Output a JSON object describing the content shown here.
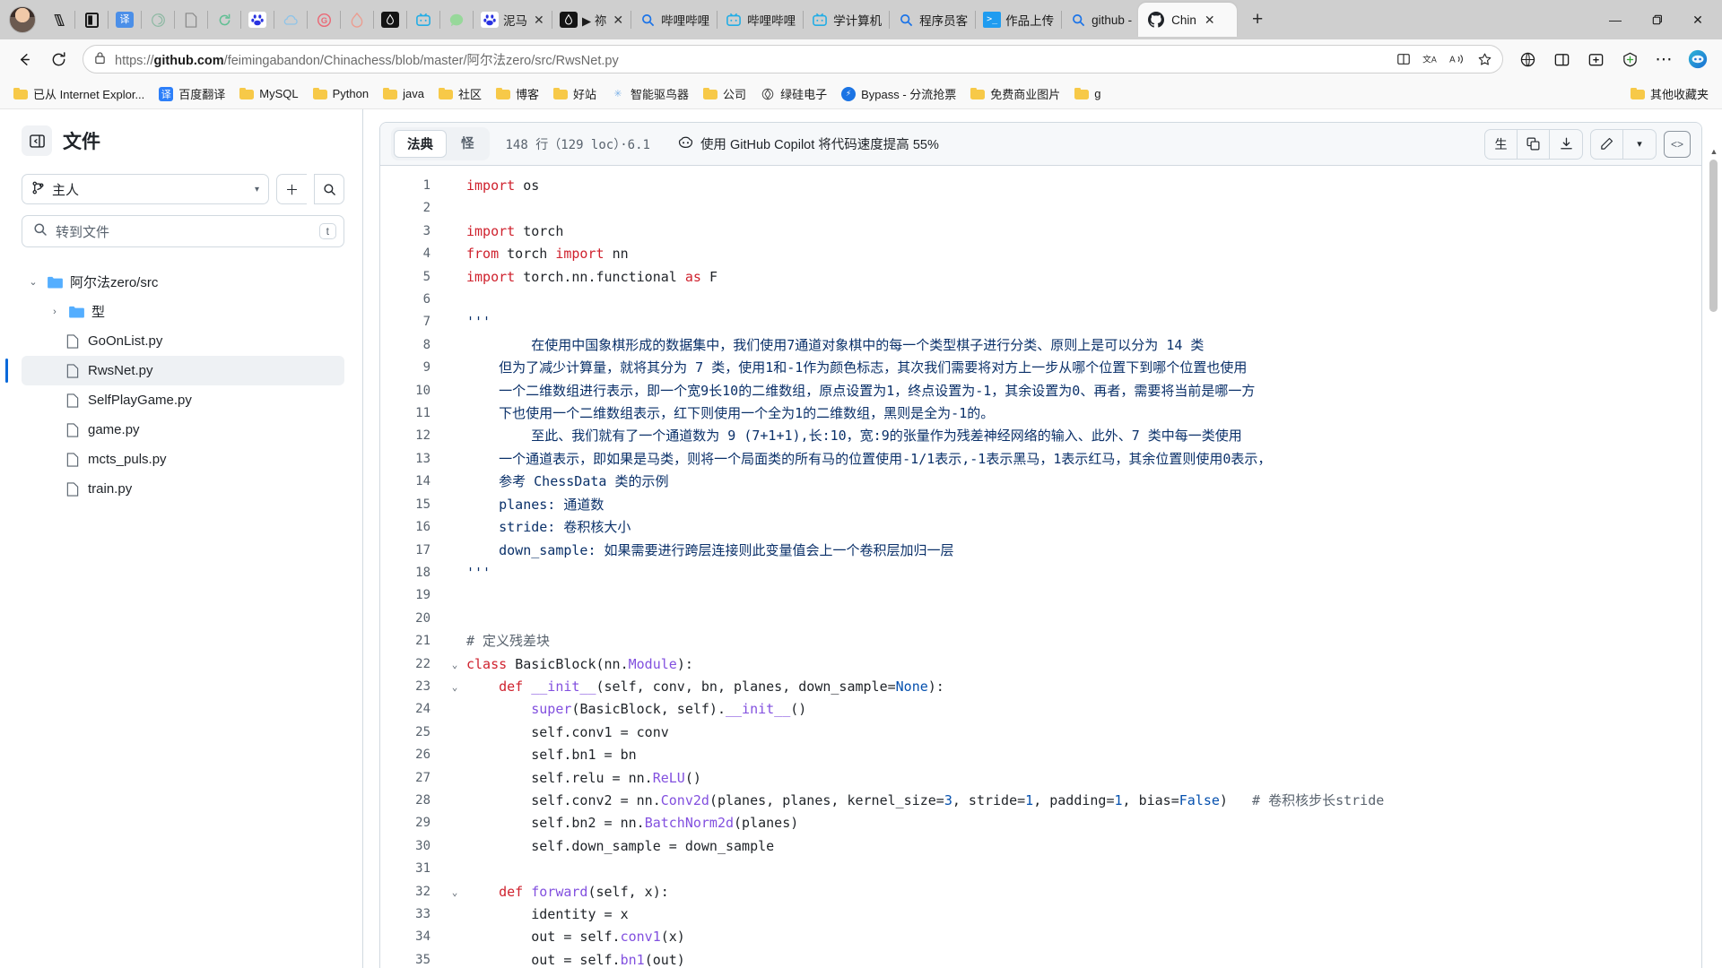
{
  "browser": {
    "pinned_tabs": [
      {
        "name": "books-icon",
        "label": ""
      },
      {
        "name": "reader-icon",
        "label": ""
      },
      {
        "name": "translate-icon",
        "label": ""
      },
      {
        "name": "openai-icon",
        "label": ""
      },
      {
        "name": "document-icon",
        "label": ""
      },
      {
        "name": "sync-icon",
        "label": ""
      },
      {
        "name": "baidu-icon",
        "label": ""
      },
      {
        "name": "cloud-icon",
        "label": ""
      },
      {
        "name": "g-icon",
        "label": ""
      },
      {
        "name": "flame-icon",
        "label": ""
      },
      {
        "name": "juejin-icon",
        "label": ""
      },
      {
        "name": "bilibili-icon",
        "label": ""
      },
      {
        "name": "wechat-icon",
        "label": ""
      }
    ],
    "tabs": [
      {
        "icon": "baidu-icon",
        "label": "泥马",
        "closable": true
      },
      {
        "icon": "juejin-icon",
        "label": "▶ 祢",
        "closable": true
      },
      {
        "icon": "search-icon",
        "label": "哔哩哔哩",
        "closable": false
      },
      {
        "icon": "bilibili-icon",
        "label": "哔哩哔哩",
        "closable": false
      },
      {
        "icon": "bilibili-icon",
        "label": "学计算机",
        "closable": false
      },
      {
        "icon": "search-icon",
        "label": "程序员客",
        "closable": false
      },
      {
        "icon": "terminal-icon",
        "label": "作品上传",
        "closable": false
      },
      {
        "icon": "search-icon",
        "label": "github -",
        "closable": false
      }
    ],
    "active_tab": {
      "icon": "github-icon",
      "label": "Chin",
      "close": "✕"
    },
    "new_tab_label": "+",
    "window_controls": {
      "minimize": "—",
      "maximize": "❐",
      "close": "✕"
    },
    "nav": {
      "back": "←",
      "reload": "⟳"
    },
    "address": {
      "lock": "🔒",
      "prefix": "https://",
      "domain": "github.com",
      "path": "/feimingabandon/Chinachess/blob/master/阿尔法zero/src/RwsNet.py",
      "split_icon": "⊞",
      "translate_icon": "文A",
      "read_aloud_icon": "A))",
      "favorite_icon": "☆",
      "collections_icon": "⊞",
      "split_screen_icon": "◫",
      "add_icon": "＋",
      "browser_essentials_icon": "◈",
      "more_icon": "⋯",
      "copilot_icon": "◉"
    },
    "bookmarks": [
      {
        "type": "folder",
        "label": "已从 Internet Explor..."
      },
      {
        "type": "site",
        "icon": "译",
        "color": "#2d7ff9",
        "label": "百度翻译"
      },
      {
        "type": "folder",
        "label": "MySQL"
      },
      {
        "type": "folder",
        "label": "Python"
      },
      {
        "type": "folder",
        "label": "java"
      },
      {
        "type": "folder",
        "label": "社区"
      },
      {
        "type": "folder",
        "label": "博客"
      },
      {
        "type": "folder",
        "label": "好站"
      },
      {
        "type": "site",
        "icon": "✳",
        "color": "#7fb3e8",
        "label": "智能驱鸟器"
      },
      {
        "type": "folder",
        "label": "公司"
      },
      {
        "type": "site",
        "icon": "◈",
        "color": "#444",
        "label": "绿硅电子"
      },
      {
        "type": "site",
        "icon": "⬤",
        "color": "#1b74e4",
        "label": "Bypass - 分流抢票"
      },
      {
        "type": "folder",
        "label": "免费商业图片"
      },
      {
        "type": "folder",
        "label": "g"
      }
    ],
    "bookmarks_right": {
      "type": "folder",
      "label": "其他收藏夹"
    }
  },
  "sidebar": {
    "collapse_icon": "◧",
    "title": "文件",
    "branch": {
      "icon": "⑂",
      "label": "主人",
      "caret": "▾"
    },
    "add_button": "＋",
    "search_button": "⌕",
    "find_file": {
      "icon": "⌕",
      "placeholder": "转到文件",
      "kbd": "t"
    },
    "tree": [
      {
        "level": 0,
        "type": "folder",
        "twist": "⌄",
        "label": "阿尔法zero/src",
        "selected": false
      },
      {
        "level": 1,
        "type": "folder",
        "twist": "›",
        "label": "型",
        "selected": false
      },
      {
        "level": 1,
        "type": "file",
        "twist": "",
        "label": "GoOnList.py",
        "selected": false
      },
      {
        "level": 1,
        "type": "file",
        "twist": "",
        "label": "RwsNet.py",
        "selected": true
      },
      {
        "level": 1,
        "type": "file",
        "twist": "",
        "label": "SelfPlayGame.py",
        "selected": false
      },
      {
        "level": 1,
        "type": "file",
        "twist": "",
        "label": "game.py",
        "selected": false
      },
      {
        "level": 1,
        "type": "file",
        "twist": "",
        "label": "mcts_puls.py",
        "selected": false
      },
      {
        "level": 1,
        "type": "file",
        "twist": "",
        "label": "train.py",
        "selected": false
      }
    ]
  },
  "code_header": {
    "tab_code": "法典",
    "tab_blame": "怪",
    "meta": "148 行（129 loc）·6.1",
    "copilot_icon": "copilot-icon",
    "copilot_text": "使用 GitHub Copilot 将代码速度提高 55%",
    "raw_button": "生",
    "copy_button": "⧉",
    "download_button": "⤓",
    "edit_button": "✎",
    "edit_caret": "▾",
    "symbols_button": "<>"
  },
  "code": {
    "lines": [
      {
        "n": 1,
        "fold": "",
        "tokens": [
          {
            "t": "import ",
            "c": "k"
          },
          {
            "t": "os",
            "c": "pl"
          }
        ]
      },
      {
        "n": 2,
        "fold": "",
        "tokens": []
      },
      {
        "n": 3,
        "fold": "",
        "tokens": [
          {
            "t": "import ",
            "c": "k"
          },
          {
            "t": "torch",
            "c": "pl"
          }
        ]
      },
      {
        "n": 4,
        "fold": "",
        "tokens": [
          {
            "t": "from ",
            "c": "k"
          },
          {
            "t": "torch ",
            "c": "pl"
          },
          {
            "t": "import ",
            "c": "k"
          },
          {
            "t": "nn",
            "c": "pl"
          }
        ]
      },
      {
        "n": 5,
        "fold": "",
        "tokens": [
          {
            "t": "import ",
            "c": "k"
          },
          {
            "t": "torch.nn.functional ",
            "c": "pl"
          },
          {
            "t": "as ",
            "c": "k"
          },
          {
            "t": "F",
            "c": "pl"
          }
        ]
      },
      {
        "n": 6,
        "fold": "",
        "tokens": []
      },
      {
        "n": 7,
        "fold": "",
        "tokens": [
          {
            "t": "'''",
            "c": "doc"
          }
        ]
      },
      {
        "n": 8,
        "fold": "",
        "tokens": [
          {
            "t": "        在使用中国象棋形成的数据集中，我们使用7通道对象棋中的每一个类型棋子进行分类、原则上是可以分为 14 类",
            "c": "doc"
          }
        ]
      },
      {
        "n": 9,
        "fold": "",
        "tokens": [
          {
            "t": "    但为了减少计算量，就将其分为 7 类，使用1和-1作为颜色标志，其次我们需要将对方上一步从哪个位置下到哪个位置也使用",
            "c": "doc"
          }
        ]
      },
      {
        "n": 10,
        "fold": "",
        "tokens": [
          {
            "t": "    一个二维数组进行表示，即一个宽9长10的二维数组，原点设置为1，终点设置为-1，其余设置为0、再者，需要将当前是哪一方",
            "c": "doc"
          }
        ]
      },
      {
        "n": 11,
        "fold": "",
        "tokens": [
          {
            "t": "    下也使用一个二维数组表示，红下则使用一个全为1的二维数组，黑则是全为-1的。",
            "c": "doc"
          }
        ]
      },
      {
        "n": 12,
        "fold": "",
        "tokens": [
          {
            "t": "        至此、我们就有了一个通道数为 9 (7+1+1),长:10，宽:9的张量作为残差神经网络的输入、此外、7 类中每一类使用",
            "c": "doc"
          }
        ]
      },
      {
        "n": 13,
        "fold": "",
        "tokens": [
          {
            "t": "    一个通道表示，即如果是马类，则将一个局面类的所有马的位置使用-1/1表示,-1表示黑马，1表示红马，其余位置则使用0表示，",
            "c": "doc"
          }
        ]
      },
      {
        "n": 14,
        "fold": "",
        "tokens": [
          {
            "t": "    参考 ChessData 类的示例",
            "c": "doc"
          }
        ]
      },
      {
        "n": 15,
        "fold": "",
        "tokens": [
          {
            "t": "    planes: 通道数",
            "c": "doc"
          }
        ]
      },
      {
        "n": 16,
        "fold": "",
        "tokens": [
          {
            "t": "    stride: 卷积核大小",
            "c": "doc"
          }
        ]
      },
      {
        "n": 17,
        "fold": "",
        "tokens": [
          {
            "t": "    down_sample: 如果需要进行跨层连接则此变量值会上一个卷积层加归一层",
            "c": "doc"
          }
        ]
      },
      {
        "n": 18,
        "fold": "",
        "tokens": [
          {
            "t": "'''",
            "c": "doc"
          }
        ]
      },
      {
        "n": 19,
        "fold": "",
        "tokens": []
      },
      {
        "n": 20,
        "fold": "",
        "tokens": []
      },
      {
        "n": 21,
        "fold": "",
        "tokens": [
          {
            "t": "# 定义残差块",
            "c": "cm"
          }
        ]
      },
      {
        "n": 22,
        "fold": "⌄",
        "tokens": [
          {
            "t": "class ",
            "c": "k"
          },
          {
            "t": "BasicBlock",
            "c": "pl"
          },
          {
            "t": "(nn.",
            "c": "pl"
          },
          {
            "t": "Module",
            "c": "fn"
          },
          {
            "t": "):",
            "c": "pl"
          }
        ]
      },
      {
        "n": 23,
        "fold": "⌄",
        "tokens": [
          {
            "t": "    ",
            "c": "pl"
          },
          {
            "t": "def ",
            "c": "k"
          },
          {
            "t": "__init__",
            "c": "fn"
          },
          {
            "t": "(self, conv, bn, planes, down_sample=",
            "c": "pl"
          },
          {
            "t": "None",
            "c": "n"
          },
          {
            "t": "):",
            "c": "pl"
          }
        ]
      },
      {
        "n": 24,
        "fold": "",
        "tokens": [
          {
            "t": "        ",
            "c": "pl"
          },
          {
            "t": "super",
            "c": "fn"
          },
          {
            "t": "(",
            "c": "pl"
          },
          {
            "t": "BasicBlock",
            "c": "pl"
          },
          {
            "t": ", self).",
            "c": "pl"
          },
          {
            "t": "__init__",
            "c": "fn"
          },
          {
            "t": "()",
            "c": "pl"
          }
        ]
      },
      {
        "n": 25,
        "fold": "",
        "tokens": [
          {
            "t": "        self.conv1 = conv",
            "c": "pl"
          }
        ]
      },
      {
        "n": 26,
        "fold": "",
        "tokens": [
          {
            "t": "        self.bn1 = bn",
            "c": "pl"
          }
        ]
      },
      {
        "n": 27,
        "fold": "",
        "tokens": [
          {
            "t": "        self.relu = nn.",
            "c": "pl"
          },
          {
            "t": "ReLU",
            "c": "fn"
          },
          {
            "t": "()",
            "c": "pl"
          }
        ]
      },
      {
        "n": 28,
        "fold": "",
        "tokens": [
          {
            "t": "        self.conv2 = nn.",
            "c": "pl"
          },
          {
            "t": "Conv2d",
            "c": "fn"
          },
          {
            "t": "(planes, planes, kernel_size=",
            "c": "pl"
          },
          {
            "t": "3",
            "c": "n"
          },
          {
            "t": ", stride=",
            "c": "pl"
          },
          {
            "t": "1",
            "c": "n"
          },
          {
            "t": ", padding=",
            "c": "pl"
          },
          {
            "t": "1",
            "c": "n"
          },
          {
            "t": ", bias=",
            "c": "pl"
          },
          {
            "t": "False",
            "c": "n"
          },
          {
            "t": ")   ",
            "c": "pl"
          },
          {
            "t": "# 卷积核步长stride",
            "c": "cm"
          }
        ]
      },
      {
        "n": 29,
        "fold": "",
        "tokens": [
          {
            "t": "        self.bn2 = nn.",
            "c": "pl"
          },
          {
            "t": "BatchNorm2d",
            "c": "fn"
          },
          {
            "t": "(planes)",
            "c": "pl"
          }
        ]
      },
      {
        "n": 30,
        "fold": "",
        "tokens": [
          {
            "t": "        self.down_sample = down_sample",
            "c": "pl"
          }
        ]
      },
      {
        "n": 31,
        "fold": "",
        "tokens": []
      },
      {
        "n": 32,
        "fold": "⌄",
        "tokens": [
          {
            "t": "    ",
            "c": "pl"
          },
          {
            "t": "def ",
            "c": "k"
          },
          {
            "t": "forward",
            "c": "fn"
          },
          {
            "t": "(self, x):",
            "c": "pl"
          }
        ]
      },
      {
        "n": 33,
        "fold": "",
        "tokens": [
          {
            "t": "        identity = x",
            "c": "pl"
          }
        ]
      },
      {
        "n": 34,
        "fold": "",
        "tokens": [
          {
            "t": "        out = self.",
            "c": "pl"
          },
          {
            "t": "conv1",
            "c": "fn"
          },
          {
            "t": "(x)",
            "c": "pl"
          }
        ]
      },
      {
        "n": 35,
        "fold": "",
        "tokens": [
          {
            "t": "        out = self.",
            "c": "pl"
          },
          {
            "t": "bn1",
            "c": "fn"
          },
          {
            "t": "(out)",
            "c": "pl"
          }
        ]
      }
    ]
  },
  "scrollbar": {
    "up_arrow": "▲"
  }
}
